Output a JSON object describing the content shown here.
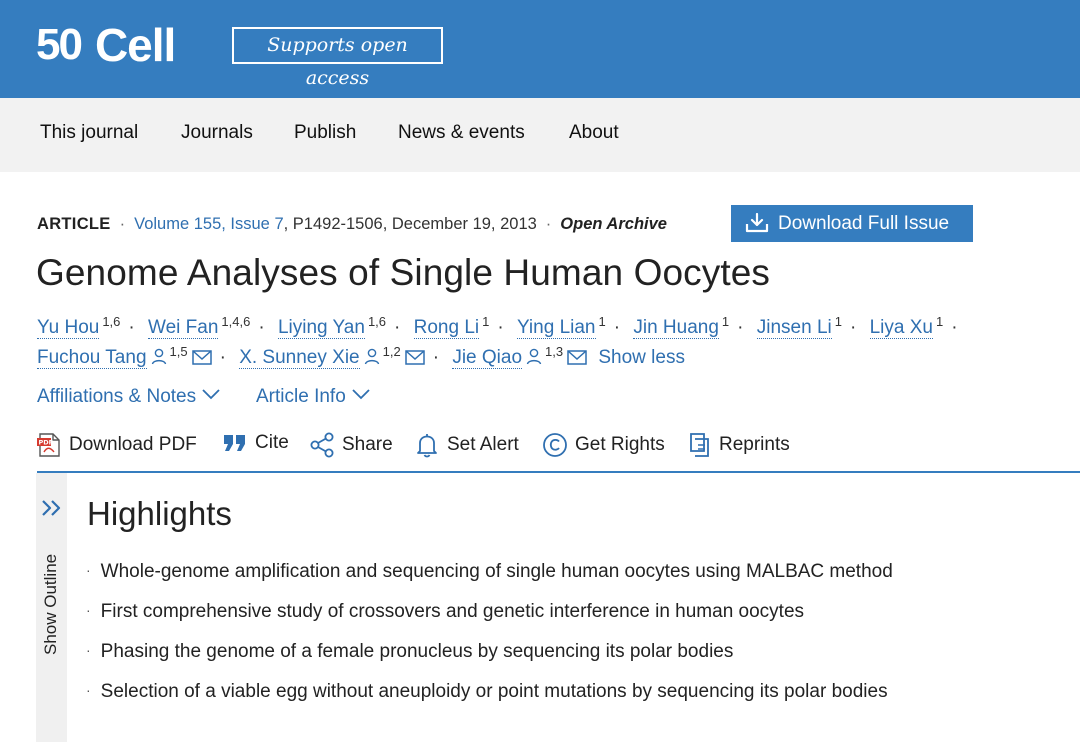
{
  "header": {
    "logo_number": "50",
    "logo_name": "Cell",
    "open_access_label": "Supports open access",
    "brand_color": "#357dbf"
  },
  "nav": {
    "items": [
      "This journal",
      "Journals",
      "Publish",
      "News & events",
      "About"
    ]
  },
  "article": {
    "type": "ARTICLE",
    "volume_issue": "Volume 155, Issue 7",
    "pages_date": ", P1492-1506, December 19, 2013",
    "access": "Open Archive",
    "download_issue_label": "Download Full Issue",
    "title": "Genome Analyses of Single Human Oocytes"
  },
  "authors": [
    {
      "name": "Yu Hou",
      "aff": "1,6",
      "contact": false
    },
    {
      "name": "Wei Fan",
      "aff": "1,4,6",
      "contact": false
    },
    {
      "name": "Liying Yan",
      "aff": "1,6",
      "contact": false
    },
    {
      "name": "Rong Li",
      "aff": "1",
      "contact": false
    },
    {
      "name": "Ying Lian",
      "aff": "1",
      "contact": false
    },
    {
      "name": "Jin Huang",
      "aff": "1",
      "contact": false
    },
    {
      "name": "Jinsen Li",
      "aff": "1",
      "contact": false
    },
    {
      "name": "Liya Xu",
      "aff": "1",
      "contact": false
    },
    {
      "name": "Fuchou Tang",
      "aff": "1,5",
      "contact": true
    },
    {
      "name": "X. Sunney Xie",
      "aff": "1,2",
      "contact": true
    },
    {
      "name": "Jie Qiao",
      "aff": "1,3",
      "contact": true
    }
  ],
  "show_less_label": "Show less",
  "info_links": {
    "affiliations": "Affiliations & Notes",
    "article_info": "Article Info"
  },
  "toolbar": {
    "download_pdf": "Download PDF",
    "cite": "Cite",
    "share": "Share",
    "set_alert": "Set Alert",
    "get_rights": "Get Rights",
    "reprints": "Reprints"
  },
  "outline": {
    "label": "Show Outline"
  },
  "highlights": {
    "title": "Highlights",
    "items": [
      "Whole-genome amplification and sequencing of single human oocytes using MALBAC method",
      "First comprehensive study of crossovers and genetic interference in human oocytes",
      "Phasing the genome of a female pronucleus by sequencing its polar bodies",
      "Selection of a viable egg without aneuploidy or point mutations by sequencing its polar bodies"
    ]
  }
}
